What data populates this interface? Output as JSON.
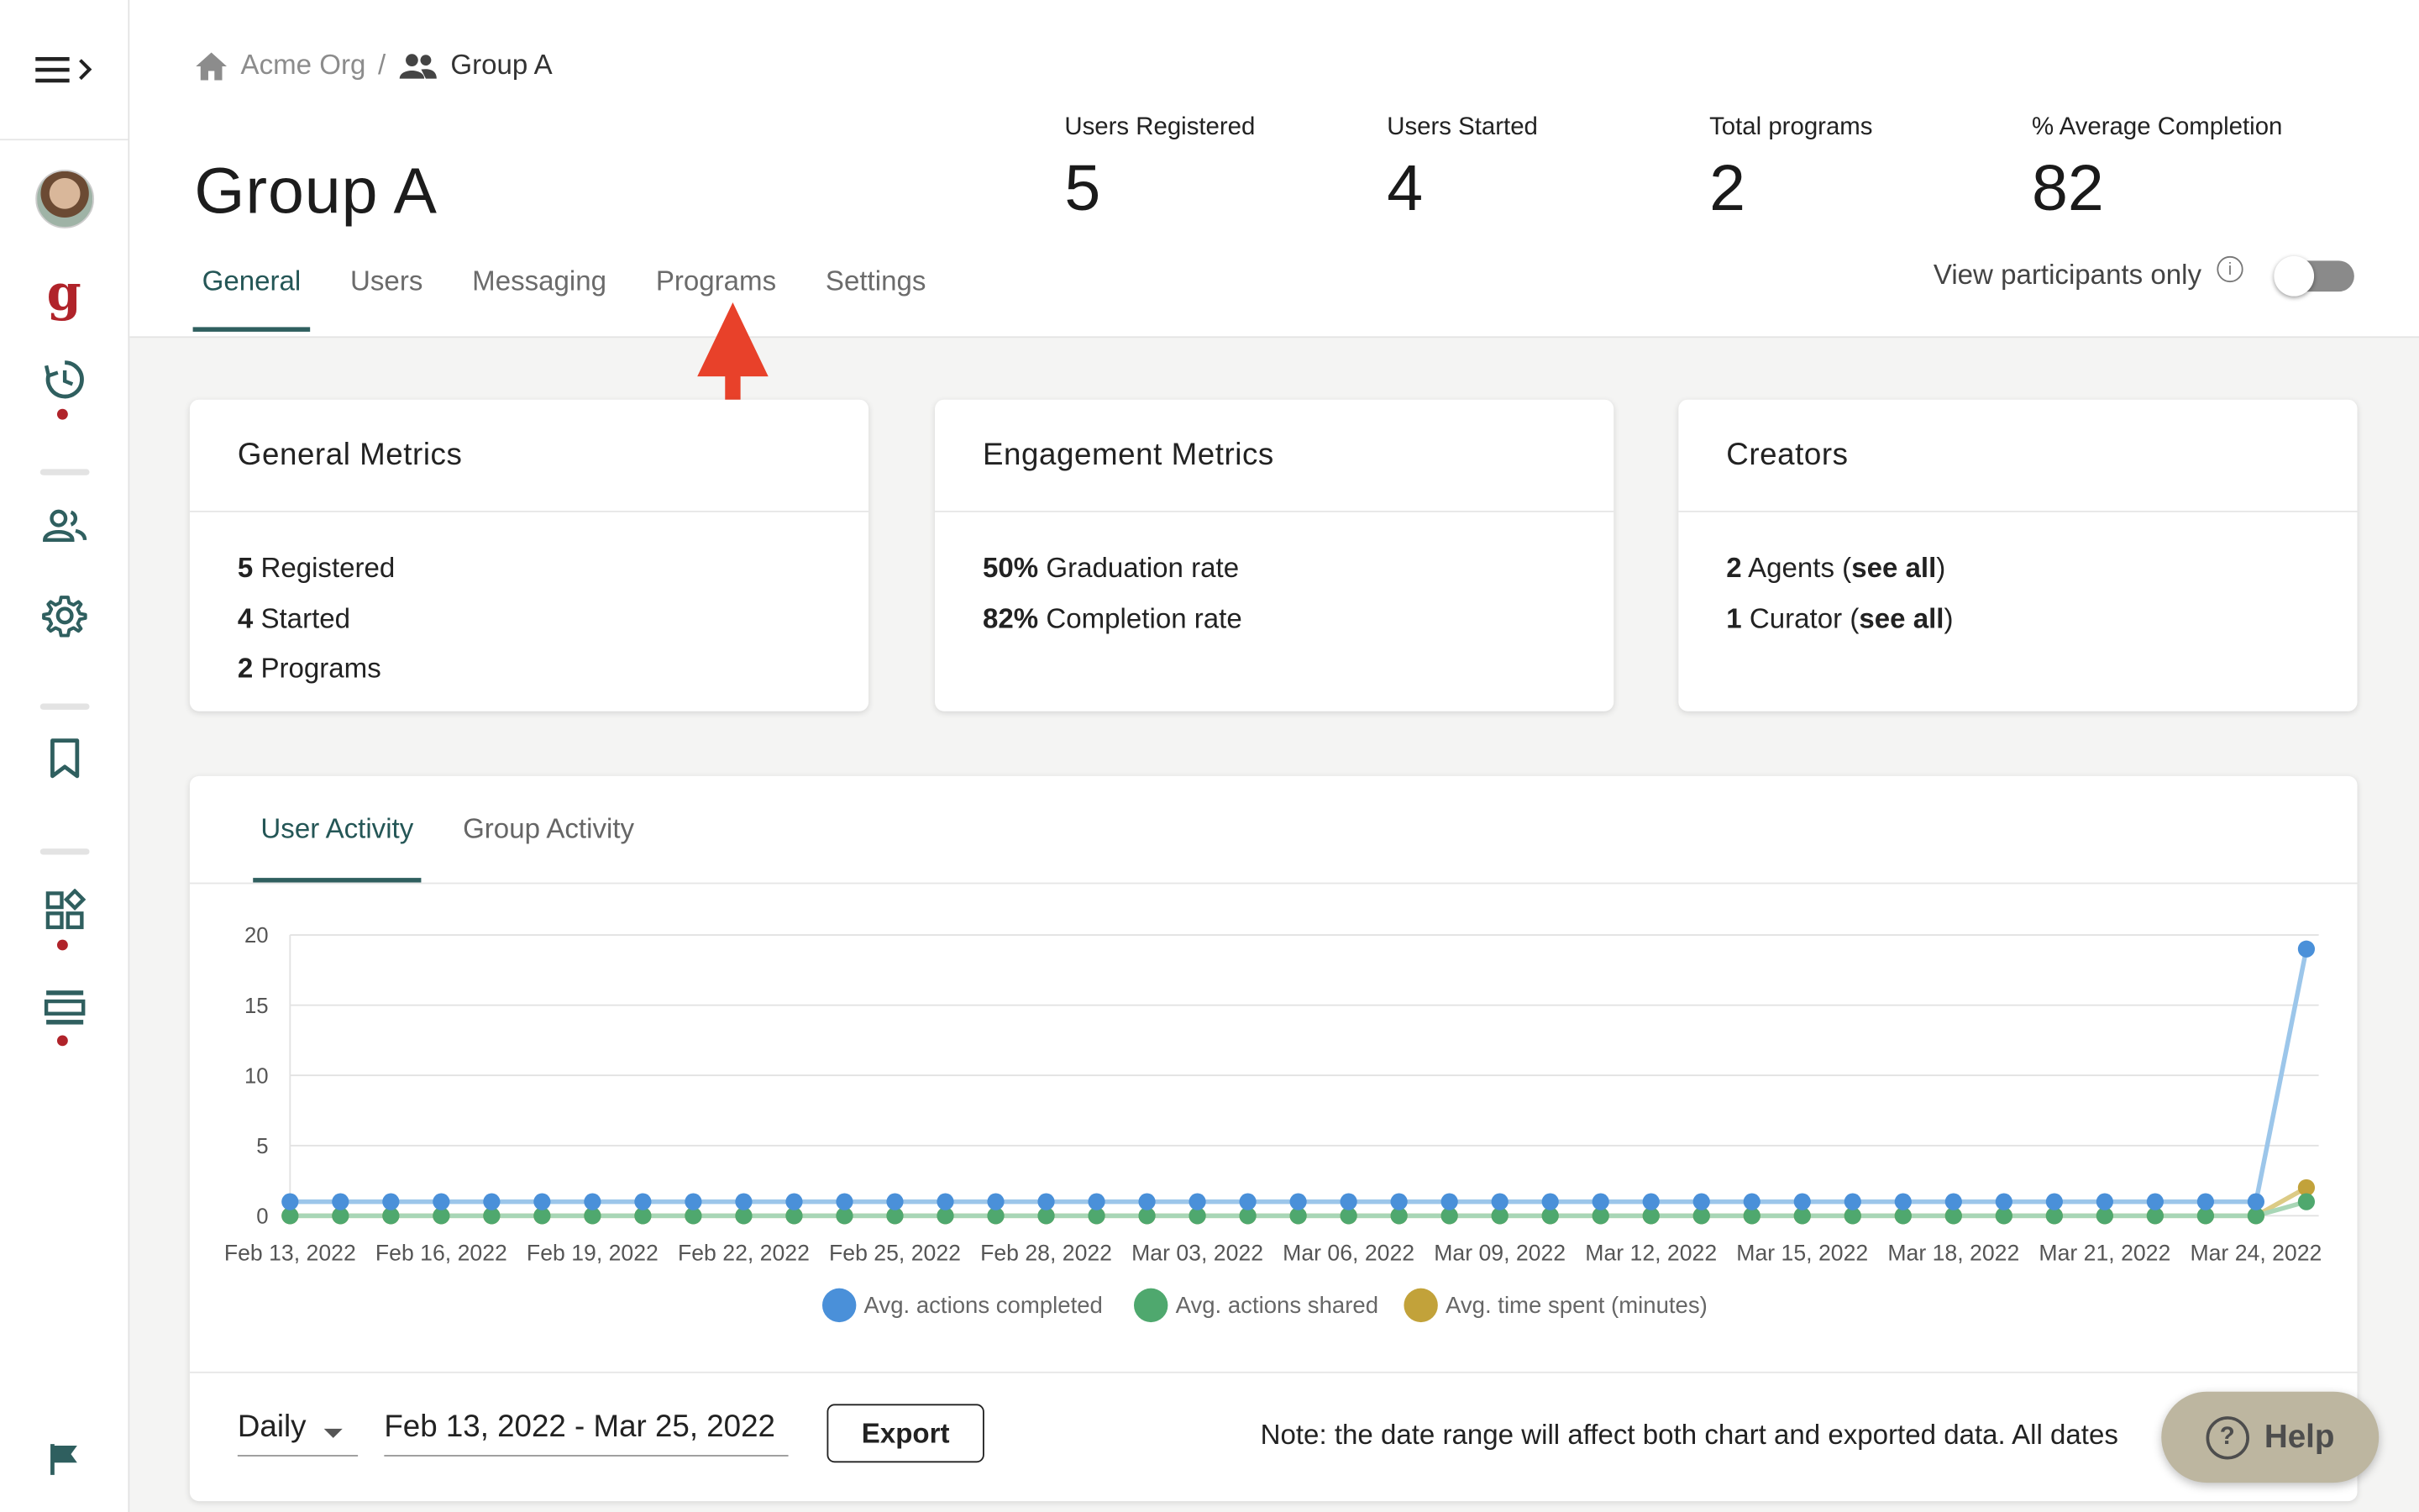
{
  "breadcrumb": {
    "org": "Acme Org",
    "separator": "/",
    "group": "Group A"
  },
  "page_title": "Group A",
  "stats": [
    {
      "label": "Users Registered",
      "value": "5"
    },
    {
      "label": "Users Started",
      "value": "4"
    },
    {
      "label": "Total programs",
      "value": "2"
    },
    {
      "label": "% Average Completion",
      "value": "82"
    }
  ],
  "tabs": [
    "General",
    "Users",
    "Messaging",
    "Programs",
    "Settings"
  ],
  "active_tab": "General",
  "participants_toggle": {
    "label": "View participants only",
    "on": false
  },
  "cards": {
    "general": {
      "title": "General Metrics",
      "rows": [
        {
          "num": "5",
          "text": " Registered"
        },
        {
          "num": "4",
          "text": " Started"
        },
        {
          "num": "2",
          "text": " Programs"
        }
      ]
    },
    "engagement": {
      "title": "Engagement Metrics",
      "rows": [
        {
          "num": "50%",
          "text": " Graduation rate"
        },
        {
          "num": "82%",
          "text": " Completion rate"
        }
      ]
    },
    "creators": {
      "title": "Creators",
      "rows": [
        {
          "num": "2",
          "text": " Agents (",
          "link": "see all",
          "tail": ")"
        },
        {
          "num": "1",
          "text": " Curator (",
          "link": "see all",
          "tail": ")"
        }
      ]
    }
  },
  "activity_tabs": [
    "User Activity",
    "Group Activity"
  ],
  "chart_data": {
    "type": "line",
    "ylim": [
      0,
      20
    ],
    "yticks": [
      "0",
      "5",
      "10",
      "15",
      "20"
    ],
    "xtick_labels": [
      "Feb 13, 2022",
      "Feb 16, 2022",
      "Feb 19, 2022",
      "Feb 22, 2022",
      "Feb 25, 2022",
      "Feb 28, 2022",
      "Mar 03, 2022",
      "Mar 06, 2022",
      "Mar 09, 2022",
      "Mar 12, 2022",
      "Mar 15, 2022",
      "Mar 18, 2022",
      "Mar 21, 2022",
      "Mar 24, 2022"
    ],
    "x_start": "2022-02-13",
    "x_end": "2022-03-25",
    "series": [
      {
        "name": "Avg. actions completed",
        "color": "#4a90d9",
        "line_color": "#9cc6ea",
        "values": [
          1,
          1,
          1,
          1,
          1,
          1,
          1,
          1,
          1,
          1,
          1,
          1,
          1,
          1,
          1,
          1,
          1,
          1,
          1,
          1,
          1,
          1,
          1,
          1,
          1,
          1,
          1,
          1,
          1,
          1,
          1,
          1,
          1,
          1,
          1,
          1,
          1,
          1,
          1,
          1,
          19
        ]
      },
      {
        "name": "Avg. actions shared",
        "color": "#4fa86e",
        "line_color": "#a8d6b6",
        "values": [
          0,
          0,
          0,
          0,
          0,
          0,
          0,
          0,
          0,
          0,
          0,
          0,
          0,
          0,
          0,
          0,
          0,
          0,
          0,
          0,
          0,
          0,
          0,
          0,
          0,
          0,
          0,
          0,
          0,
          0,
          0,
          0,
          0,
          0,
          0,
          0,
          0,
          0,
          0,
          0,
          1
        ]
      },
      {
        "name": "Avg. time spent (minutes)",
        "color": "#c2a23a",
        "line_color": "#dccb85",
        "values": [
          0,
          0,
          0,
          0,
          0,
          0,
          0,
          0,
          0,
          0,
          0,
          0,
          0,
          0,
          0,
          0,
          0,
          0,
          0,
          0,
          0,
          0,
          0,
          0,
          0,
          0,
          0,
          0,
          0,
          0,
          0,
          0,
          0,
          0,
          0,
          0,
          0,
          0,
          0,
          0,
          2
        ]
      }
    ]
  },
  "controls": {
    "interval": "Daily",
    "date_range": "Feb 13, 2022 - Mar 25, 2022",
    "export": "Export",
    "note": "Note: the date range will affect both chart and exported data. All dates"
  },
  "help": {
    "label": "Help"
  }
}
